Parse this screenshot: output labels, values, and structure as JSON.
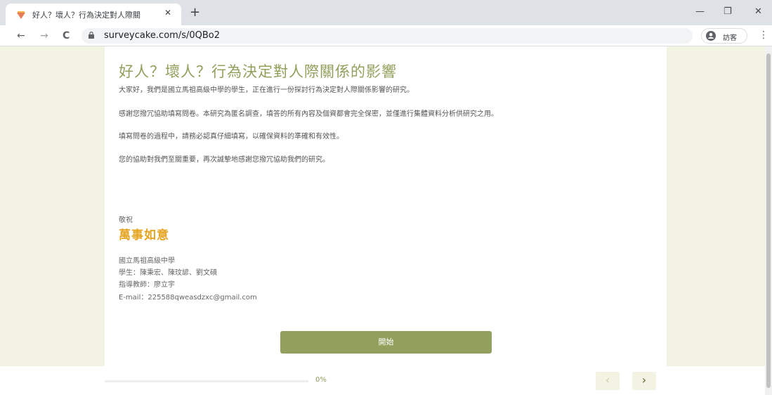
{
  "browser": {
    "tab_title": "好人？壞人？行為決定對人際關",
    "tab_close": "✕",
    "new_tab": "+",
    "url": "surveycake.com/s/0QBo2",
    "profile_label": "訪客",
    "window_controls": {
      "minimize": "—",
      "restore": "❐",
      "close": "✕"
    },
    "nav": {
      "back": "←",
      "forward": "→",
      "reload": "C",
      "menu": "⋮"
    }
  },
  "survey": {
    "title": "好人？壞人？行為決定對人際關係的影響",
    "paragraphs": [
      "大家好，我們是國立馬祖高級中學的學生，正在進行一份探討行為決定對人際關係影響的研究。",
      "感謝您撥冗協助填寫問卷。本研究為匿名調查，填答的所有內容及個資都會完全保密，並僅進行集體資料分析供研究之用。",
      "填寫問卷的過程中，請務必認真仔細填寫，以確保資料的準確和有效性。",
      "您的協助對我們至關重要，再次誠摯地感謝您撥冗協助我們的研究。"
    ],
    "closing_greeting": "敬祝",
    "closing_wish": "萬事如意",
    "signature": [
      "國立馬祖高級中學",
      "學生：陳秉宏、陳玟諺、劉文碩",
      "指導教師：廖立宇",
      "E-mail：225588qweasdzxc@gmail.com"
    ],
    "start_label": "開始"
  },
  "footer": {
    "progress": 0,
    "progress_label": "0%",
    "prev": "‹",
    "next": "›"
  },
  "colors": {
    "accent": "#91a05c",
    "wish": "#e6a421",
    "background": "#f2f3e3"
  }
}
